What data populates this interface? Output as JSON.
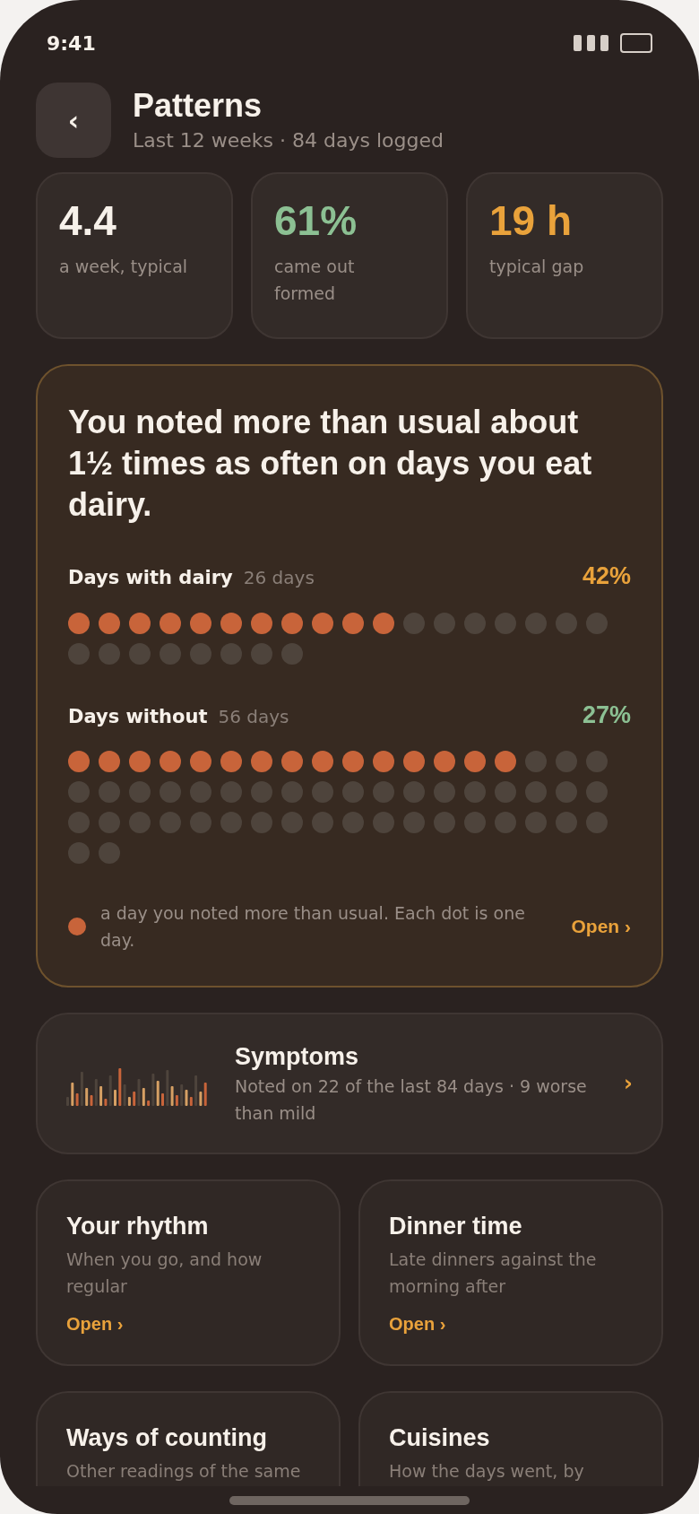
{
  "status_bar": {
    "time": "9:41"
  },
  "header": {
    "back": "‹",
    "title": "Patterns",
    "subtitle": "Last 12 weeks · 84 days logged"
  },
  "stats": [
    {
      "value": "4.4",
      "label": "a week, typical",
      "color": "#f7f1ea"
    },
    {
      "value": "61%",
      "label": "came out formed",
      "color": "#8cc093"
    },
    {
      "value": "19 h",
      "label": "typical gap",
      "color": "#e9a23b"
    }
  ],
  "insight": {
    "headline": "You noted more than usual about 1½ times as often on days you eat dairy.",
    "groups": [
      {
        "label": "Days with dairy",
        "count": "26 days",
        "percent": "42%",
        "color": "#e9a23b",
        "dots": [
          true,
          true,
          true,
          true,
          true,
          true,
          true,
          true,
          true,
          true,
          true,
          false,
          false,
          false,
          false,
          false,
          false,
          false,
          false,
          false,
          false,
          false,
          false,
          false,
          false,
          false
        ]
      },
      {
        "label": "Days without",
        "count": "56 days",
        "percent": "27%",
        "color": "#8cc093",
        "dots": [
          true,
          true,
          true,
          true,
          true,
          true,
          true,
          true,
          true,
          true,
          true,
          true,
          true,
          true,
          true,
          false,
          false,
          false,
          false,
          false,
          false,
          false,
          false,
          false,
          false,
          false,
          false,
          false,
          false,
          false,
          false,
          false,
          false,
          false,
          false,
          false,
          false,
          false,
          false,
          false,
          false,
          false,
          false,
          false,
          false,
          false,
          false,
          false,
          false,
          false,
          false,
          false,
          false,
          false,
          false,
          false
        ]
      }
    ],
    "legend": "a day you noted more than usual. Each dot is one day.",
    "open": "Open ›"
  },
  "symptoms": {
    "title": "Symptoms",
    "text": "Noted on 22 of the last 84 days · 9 worse than mild",
    "chevron": "›"
  },
  "cards": [
    {
      "title": "Your rhythm",
      "text": "When you go, and how regular",
      "open": "Open ›"
    },
    {
      "title": "Dinner time",
      "text": "Late dinners against the morning after",
      "open": "Open ›"
    },
    {
      "title": "Ways of counting",
      "text": "Other readings of the same"
    },
    {
      "title": "Cuisines",
      "text": "How the days went, by"
    }
  ]
}
